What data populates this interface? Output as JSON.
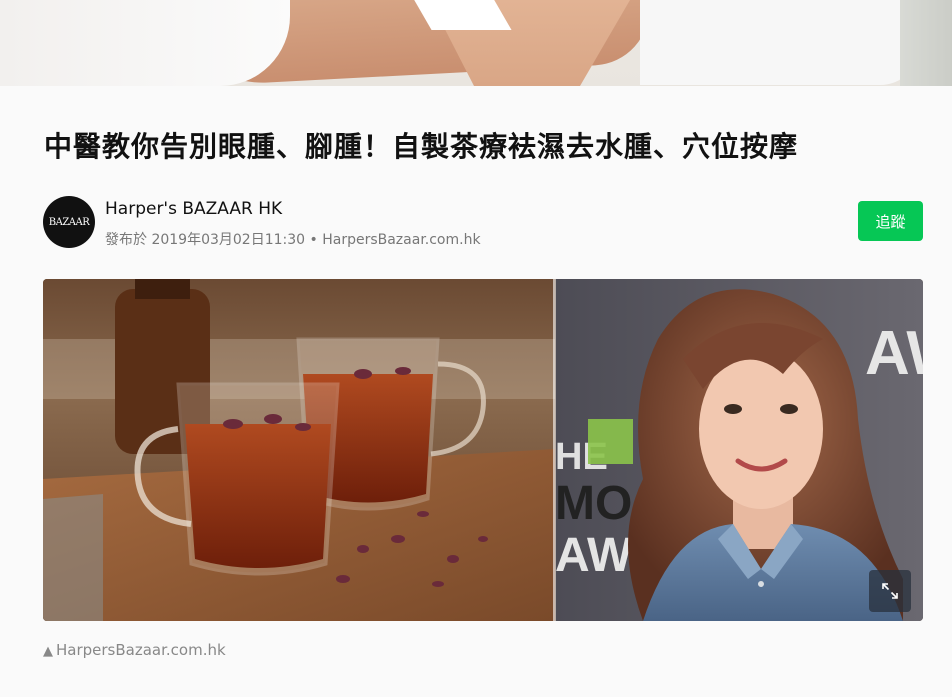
{
  "article": {
    "title": "中醫教你告別眼腫、腳腫！自製茶療袪濕去水腫、穴位按摩"
  },
  "author": {
    "avatar_text": "BAZAAR",
    "name": "Harper's BAZAAR HK",
    "meta": "發布於 2019年03月02日11:30 • HarpersBazaar.com.hk"
  },
  "actions": {
    "follow_label": "追蹤"
  },
  "hero": {
    "caption_icon": "▲",
    "caption": "HarpersBazaar.com.hk",
    "background_sign_right": "AW",
    "background_sign_left_top": "HE",
    "background_sign_left_mid": "MO",
    "background_sign_left_bot": "AWA"
  },
  "colors": {
    "follow_green": "#06c755",
    "text_dark": "#111111",
    "text_muted": "#777777"
  }
}
